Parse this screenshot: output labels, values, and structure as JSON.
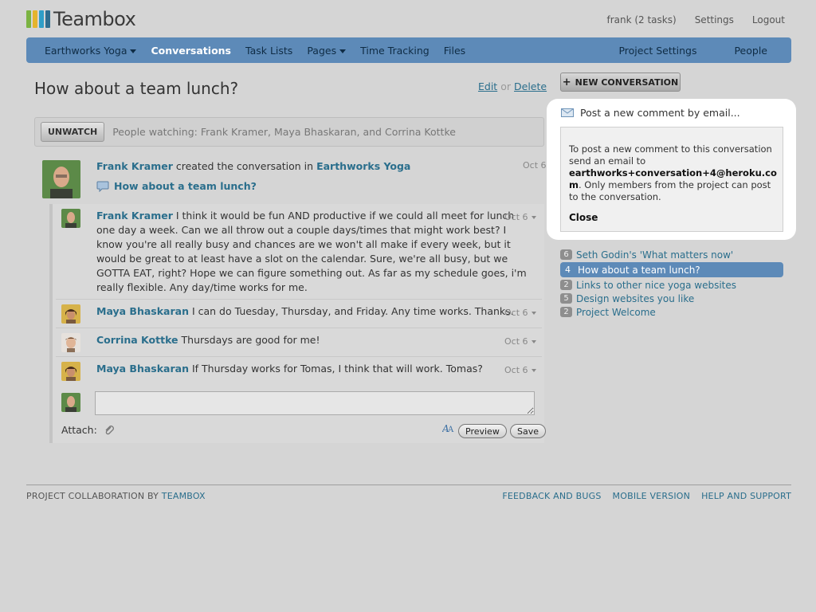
{
  "app": {
    "name": "Teambox",
    "logo_colors": [
      "#7bb342",
      "#e4b42d",
      "#2f9ec7",
      "#2f6d8f"
    ]
  },
  "top_links": {
    "user": "frank (2 tasks)",
    "settings": "Settings",
    "logout": "Logout"
  },
  "nav": {
    "project": "Earthworks Yoga",
    "conversations": "Conversations",
    "task_lists": "Task Lists",
    "pages": "Pages",
    "time_tracking": "Time Tracking",
    "files": "Files",
    "project_settings": "Project Settings",
    "people": "People"
  },
  "conversation": {
    "title": "How about a team lunch?",
    "edit": "Edit",
    "or": "or",
    "delete": "Delete",
    "unwatch": "UNWATCH",
    "watchers": "People watching: Frank Kramer, Maya Bhaskaran, and Corrina Kottke",
    "creator": "Frank Kramer",
    "created_text": "created the conversation in",
    "project": "Earthworks Yoga",
    "created_date": "Oct 6",
    "subject": "How about a team lunch?"
  },
  "comments": [
    {
      "author": "Frank Kramer",
      "text": "I think it would be fun AND productive if we could all meet for lunch one day a week. Can we all throw out a couple days/times that might work best? I know you're all really busy and chances are we won't all make if every week, but it would be great to at least have a slot on the calendar. Sure, we're all busy, but we GOTTA EAT, right? Hope we can figure something out. As far as my schedule goes, i'm really flexible. Any day/time works for me.",
      "date": "Oct 6"
    },
    {
      "author": "Maya Bhaskaran",
      "text": "I can do Tuesday, Thursday, and Friday. Any time works. Thanks.",
      "date": "Oct 6"
    },
    {
      "author": "Corrina Kottke",
      "text": "Thursdays are good for me!",
      "date": "Oct 6"
    },
    {
      "author": "Maya Bhaskaran",
      "text": "If Thursday works for Tomas, I think that will work. Tomas?",
      "date": "Oct 6"
    }
  ],
  "reply": {
    "attach_label": "Attach:",
    "preview": "Preview",
    "save": "Save"
  },
  "sidebar": {
    "new_conversation": "NEW CONVERSATION",
    "email_title": "Post a new comment by email...",
    "email_text_1": "To post a new comment to this conversation send an email to",
    "email_address_1": "earthworks+conversation+4@heroku.co",
    "email_address_2": "m",
    "email_text_2": ". Only members from the project can post to the conversation.",
    "close": "Close",
    "conversations": [
      {
        "count": "6",
        "title": "Seth Godin's 'What matters now'"
      },
      {
        "count": "4",
        "title": "How about a team lunch?"
      },
      {
        "count": "2",
        "title": "Links to other nice yoga websites"
      },
      {
        "count": "5",
        "title": "Design websites you like"
      },
      {
        "count": "2",
        "title": "Project Welcome"
      }
    ]
  },
  "footer": {
    "left_prefix": "PROJECT COLLABORATION BY",
    "left_link": "TEAMBOX",
    "feedback": "FEEDBACK AND BUGS",
    "mobile": "MOBILE VERSION",
    "help": "HELP AND SUPPORT"
  }
}
